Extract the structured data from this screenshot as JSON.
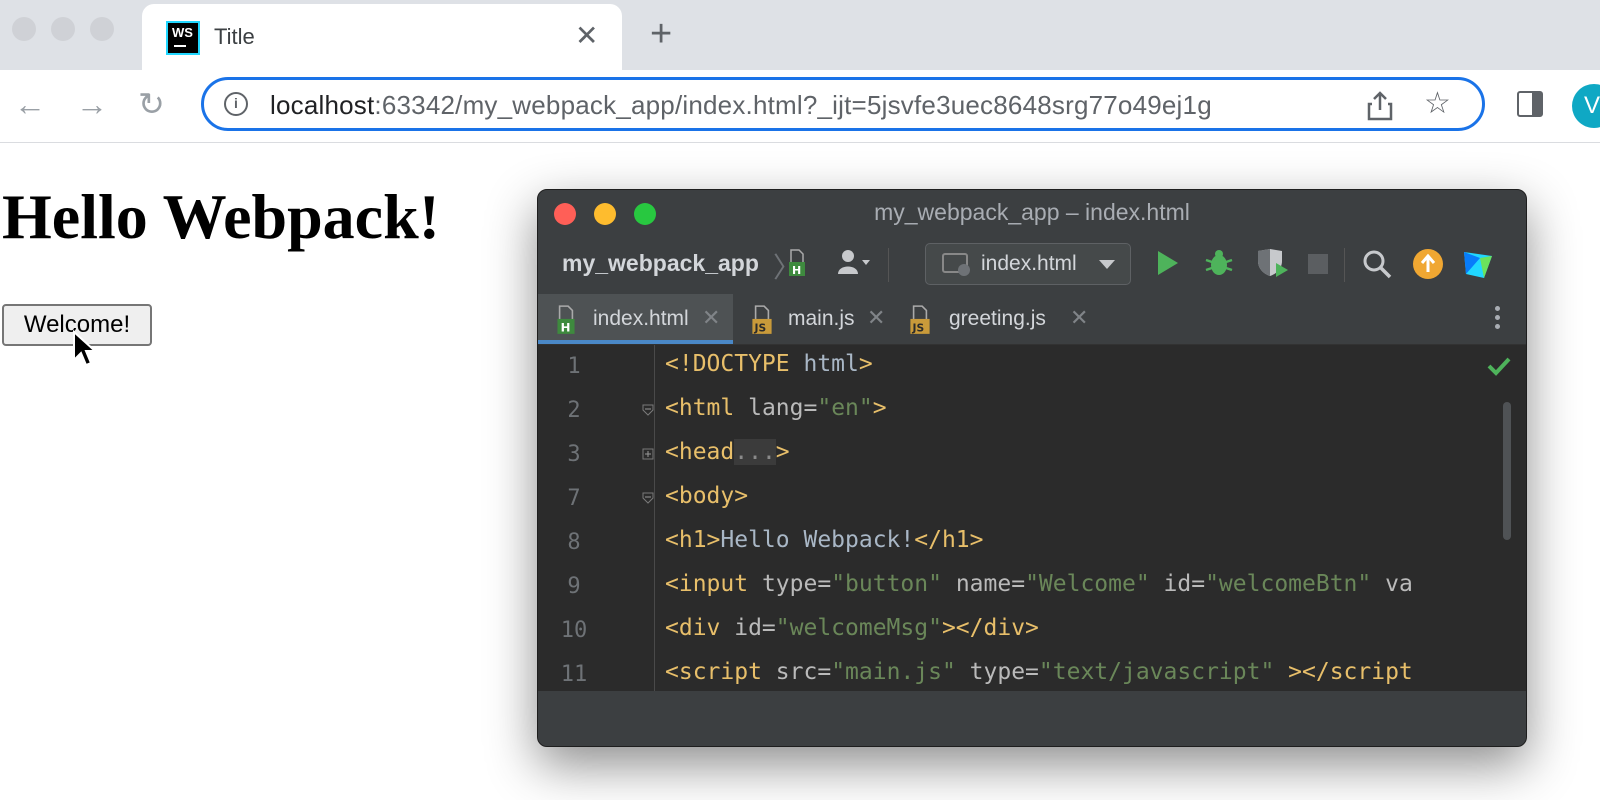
{
  "browser": {
    "tab": {
      "title": "Title",
      "favicon_text": "WS"
    },
    "url": {
      "host": "localhost",
      "rest": ":63342/my_webpack_app/index.html?_ijt=5jsvfe3uec8648srg77o49ej1g"
    },
    "avatar_letter": "V"
  },
  "page": {
    "heading": "Hello Webpack!",
    "button_label": "Welcome!"
  },
  "ide": {
    "window_title": "my_webpack_app – index.html",
    "project_name": "my_webpack_app",
    "run_config": "index.html",
    "tabs": [
      {
        "label": "index.html",
        "icon": "html-file-icon",
        "active": true
      },
      {
        "label": "main.js",
        "icon": "js-file-icon",
        "active": false
      },
      {
        "label": "greeting.js",
        "icon": "js-file-icon",
        "active": false
      }
    ],
    "line_numbers": [
      "1",
      "2",
      "3",
      "7",
      "8",
      "9",
      "10",
      "11"
    ],
    "code": {
      "l1_tag": "<!DOCTYPE",
      "l1_rest": " html",
      "l1_end": ">",
      "l2_tag": "<html",
      "l2_attr": " lang=",
      "l2_val": "\"en\"",
      "l2_end": ">",
      "l3_tag": "<head",
      "l3_dots": "...",
      "l3_end": ">",
      "l4_tag": "<body>",
      "l5_open": "<h1>",
      "l5_text": "Hello Webpack!",
      "l5_close": "</h1>",
      "l6_tag": "<input",
      "l6_a1": " type=",
      "l6_v1": "\"button\"",
      "l6_a2": " name=",
      "l6_v2": "\"Welcome\"",
      "l6_a3": " id=",
      "l6_v3": "\"welcomeBtn\"",
      "l6_a4": " va",
      "l7_tag": "<div",
      "l7_a1": " id=",
      "l7_v1": "\"welcomeMsg\"",
      "l7_end": "></div>",
      "l8_tag": "<script",
      "l8_a1": " src=",
      "l8_v1": "\"main.js\"",
      "l8_a2": " type=",
      "l8_v2": "\"text/javascript\"",
      "l8_end": " ></script"
    }
  },
  "colors": {
    "omnibox_focus": "#1a73e8",
    "ide_bg": "#2b2b2b",
    "ide_chrome": "#3c3f41",
    "tag": "#e8bf6a",
    "value": "#6a8759",
    "active_tab_underline": "#4a88c7",
    "close_dot": "#ff5f57",
    "minimize_dot": "#febc2e",
    "zoom_dot": "#28c840"
  }
}
